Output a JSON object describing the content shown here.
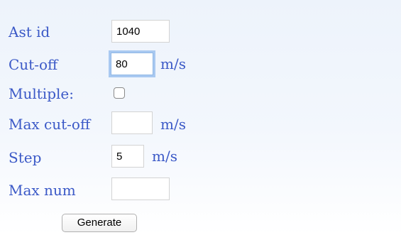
{
  "form": {
    "ast_id": {
      "label": "Ast id",
      "value": "1040"
    },
    "cutoff": {
      "label": "Cut-off",
      "value": "80",
      "unit": "m/s"
    },
    "multiple": {
      "label": "Multiple:",
      "checked": false
    },
    "max_cutoff": {
      "label": "Max cut-off",
      "value": "",
      "unit": "m/s"
    },
    "step": {
      "label": "Step",
      "value": "5",
      "unit": "m/s"
    },
    "max_num": {
      "label": "Max num",
      "value": ""
    },
    "generate_label": "Generate"
  }
}
